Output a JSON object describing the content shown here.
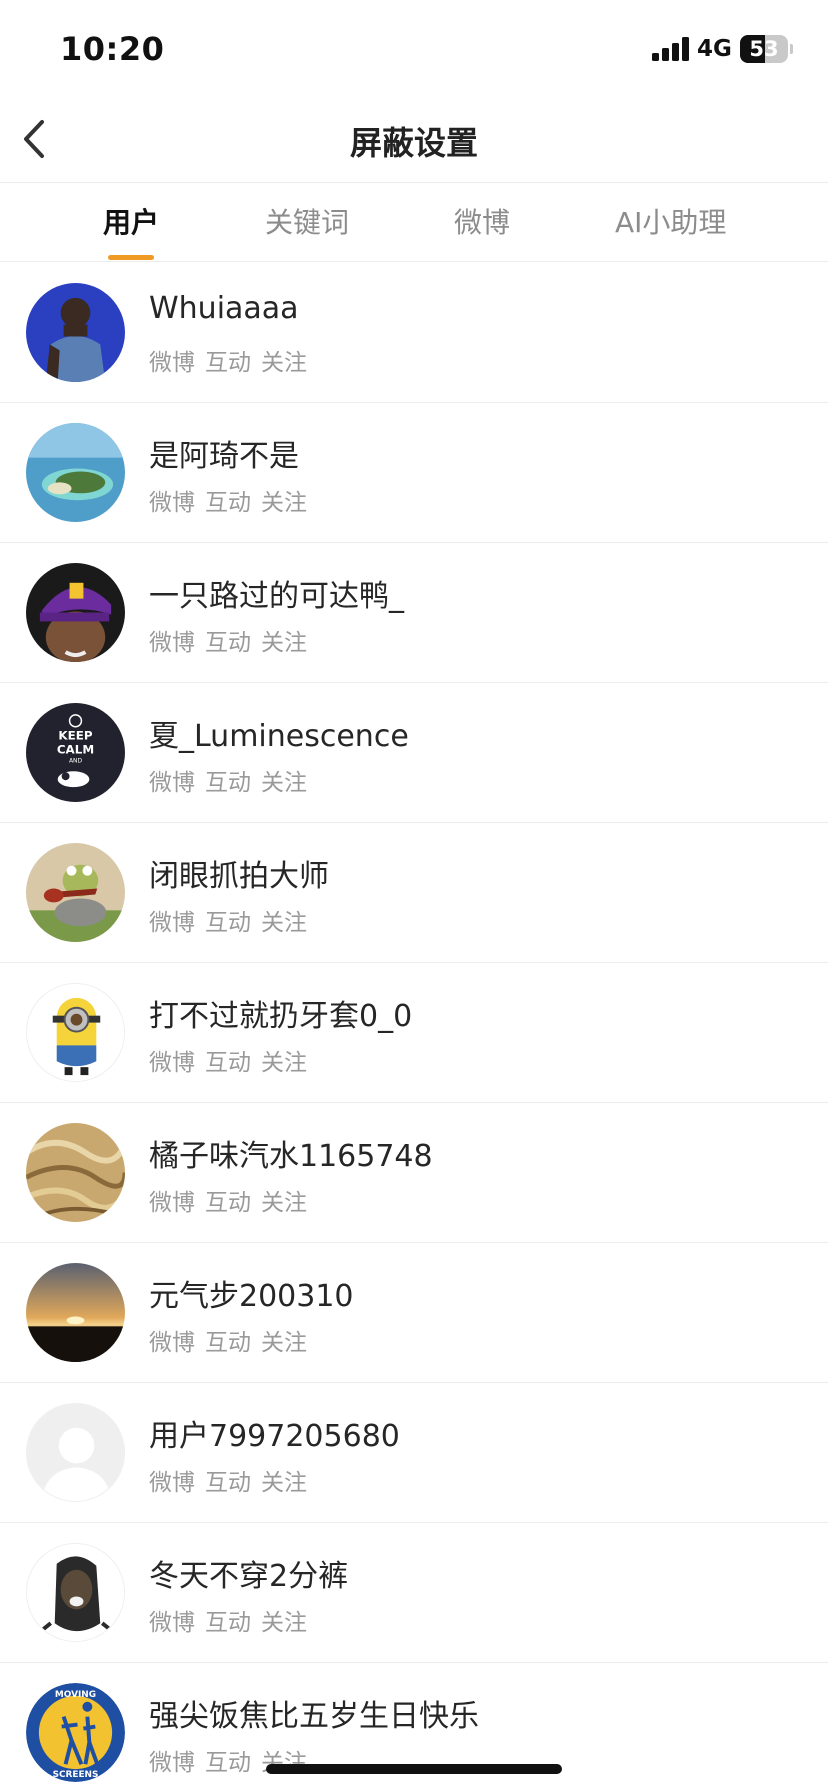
{
  "status_bar": {
    "time": "10:20",
    "network": "4G",
    "battery_level": "53",
    "battery_fraction": 0.53
  },
  "nav": {
    "back_icon": "chevron-left-icon",
    "title": "屏蔽设置"
  },
  "tabs": [
    {
      "label": "用户",
      "active": true
    },
    {
      "label": "关键词",
      "active": false
    },
    {
      "label": "微博",
      "active": false
    },
    {
      "label": "AI小助理",
      "active": false
    }
  ],
  "accent_color": "#f09a26",
  "users": [
    {
      "name": "Whuiaaaa",
      "tags": [
        "微博",
        "互动",
        "关注"
      ],
      "avatar": "player-photo"
    },
    {
      "name": "是阿琦不是",
      "tags": [
        "微博",
        "互动",
        "关注"
      ],
      "avatar": "island-photo"
    },
    {
      "name": "一只路过的可达鸭_",
      "tags": [
        "微博",
        "互动",
        "关注"
      ],
      "avatar": "cap-photo"
    },
    {
      "name": "夏_Luminescence",
      "tags": [
        "微博",
        "互动",
        "关注"
      ],
      "avatar": "keep-calm-badge",
      "avatar_text": [
        "KEEP",
        "CALM",
        "AND"
      ]
    },
    {
      "name": "闭眼抓拍大师",
      "tags": [
        "微博",
        "互动",
        "关注"
      ],
      "avatar": "frog-guitar-illustration"
    },
    {
      "name": "打不过就扔牙套0_0",
      "tags": [
        "微博",
        "互动",
        "关注"
      ],
      "avatar": "minion-illustration"
    },
    {
      "name": "橘子味汽水1165748",
      "tags": [
        "微博",
        "互动",
        "关注"
      ],
      "avatar": "hair-closeup-photo"
    },
    {
      "name": "元气步200310",
      "tags": [
        "微博",
        "互动",
        "关注"
      ],
      "avatar": "sunset-photo"
    },
    {
      "name": "用户7997205680",
      "tags": [
        "微博",
        "互动",
        "关注"
      ],
      "avatar": "default-avatar-icon"
    },
    {
      "name": "冬天不穿2分裤",
      "tags": [
        "微博",
        "互动",
        "关注"
      ],
      "avatar": "meme-face-photo"
    },
    {
      "name": "强尖饭焦比五岁生日快乐",
      "tags": [
        "微博",
        "互动",
        "关注"
      ],
      "avatar": "moving-screens-logo",
      "avatar_text": [
        "MOVING",
        "SCREENS"
      ]
    }
  ]
}
